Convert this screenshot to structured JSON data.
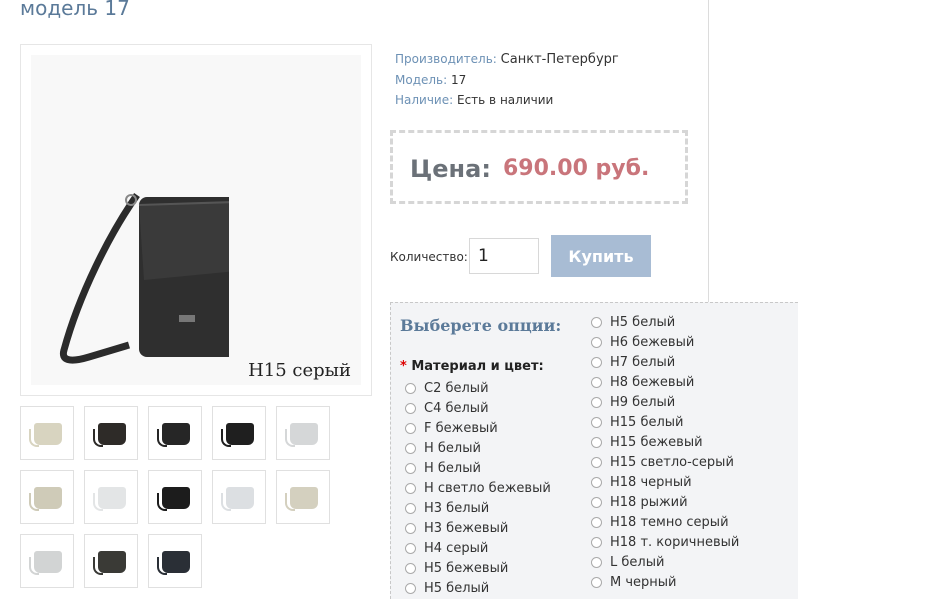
{
  "product": {
    "title": "модель 17",
    "image_caption": "H15 серый"
  },
  "info": {
    "manufacturer_label": "Производитель:",
    "manufacturer_value": "Санкт-Петербург",
    "model_label": "Модель:",
    "model_value": "17",
    "stock_label": "Наличие:",
    "stock_value": "Есть в наличии"
  },
  "price": {
    "label": "Цена:",
    "value": "690.00 руб."
  },
  "purchase": {
    "qty_label": "Количество:",
    "qty_value": "1",
    "buy_label": "Купить"
  },
  "options": {
    "title": "Выберете опции:",
    "required_star": "*",
    "group_label": "Материал и цвет:",
    "col1": [
      "C2 белый",
      "C4 белый",
      "F бежевый",
      "H белый",
      "H белый",
      "H светло бежевый",
      "H3 белый",
      "H3 бежевый",
      "H4 серый",
      "H5 бежевый",
      "H5 белый"
    ],
    "col2": [
      "H5 белый",
      "H6 бежевый",
      "H7 белый",
      "H8 бежевый",
      "H9 белый",
      "H15 белый",
      "H15 бежевый",
      "H15 светло-серый",
      "H18 черный",
      "H18 рыжий",
      "H18 темно серый",
      "H18 т. коричневый",
      "L белый",
      "M черный"
    ]
  },
  "thumbnails": [
    {
      "color": "#d8d4c0"
    },
    {
      "color": "#2e2b28"
    },
    {
      "color": "#262626"
    },
    {
      "color": "#1f1f1f"
    },
    {
      "color": "#d5d7d8"
    },
    {
      "color": "#cfcbb8"
    },
    {
      "color": "#e3e5e6"
    },
    {
      "color": "#1c1c1c"
    },
    {
      "color": "#dcdfe2"
    },
    {
      "color": "#d4d0bf"
    },
    {
      "color": "#d2d4d4"
    },
    {
      "color": "#3a3a36"
    },
    {
      "color": "#2a2f36"
    }
  ]
}
